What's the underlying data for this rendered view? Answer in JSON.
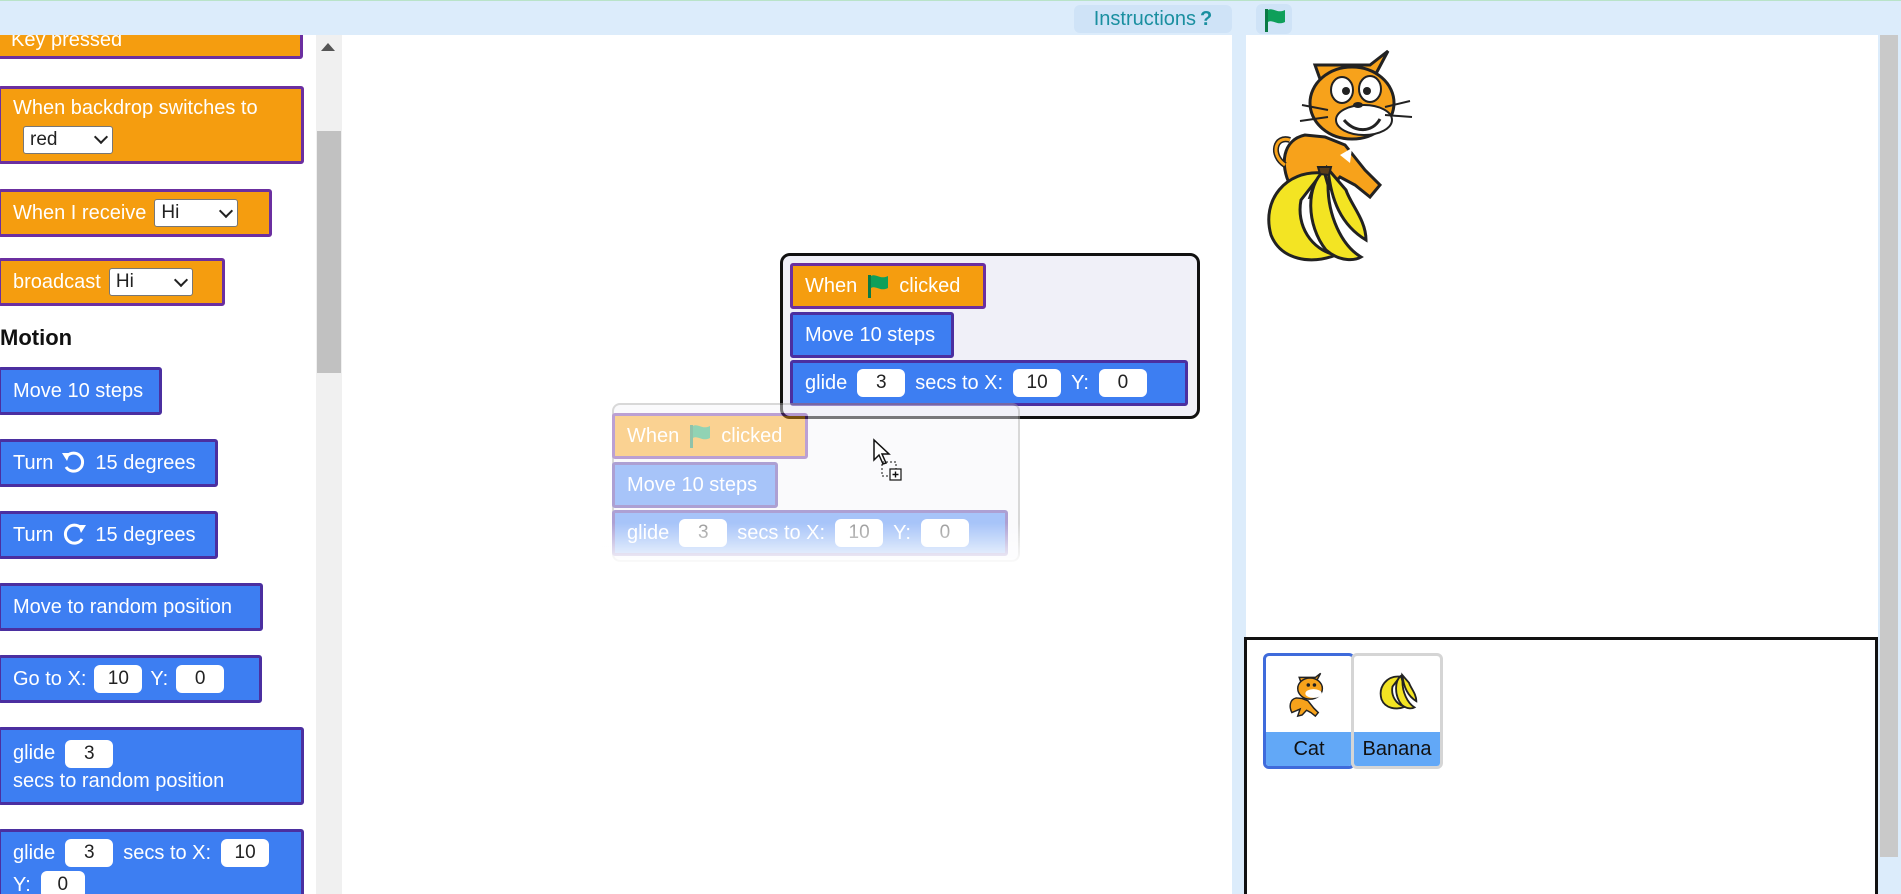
{
  "topbar": {
    "instructions_label": "Instructions",
    "instructions_icon": "?",
    "green_flag_icon": "green-flag-icon"
  },
  "palette": {
    "key_pressed_label": "Key pressed",
    "backdrop": {
      "label": "When backdrop switches to",
      "value": "red"
    },
    "receive": {
      "label": "When I receive",
      "value": "Hi"
    },
    "broadcast": {
      "label": "broadcast",
      "value": "Hi"
    },
    "motion_heading": "Motion",
    "move": "Move 10 steps",
    "turn_left": {
      "label": "Turn",
      "suffix": "15 degrees",
      "icon": "rotate-left-icon"
    },
    "turn_right": {
      "label": "Turn",
      "suffix": "15 degrees",
      "icon": "rotate-right-icon"
    },
    "random_position": "Move to random position",
    "goto": {
      "label": "Go to X:",
      "x": "10",
      "y_label": "Y:",
      "y": "0"
    },
    "glide_random": {
      "label": "glide",
      "secs": "3",
      "suffix": "secs to random position"
    },
    "glide_xy": {
      "label": "glide",
      "secs": "3",
      "mid": "secs to X:",
      "x": "10",
      "y_label": "Y:",
      "y": "0"
    }
  },
  "script": {
    "when_label": "When",
    "clicked_label": "clicked",
    "move": "Move 10 steps",
    "glide_label": "glide",
    "glide_secs": "3",
    "glide_mid": "secs to X:",
    "glide_x": "10",
    "glide_y_label": "Y:",
    "glide_y": "0"
  },
  "sprites": [
    {
      "name": "Cat",
      "selected": true
    },
    {
      "name": "Banana",
      "selected": false
    }
  ],
  "colors": {
    "event": "#f59d0f",
    "motion": "#3d7ef2",
    "border": "#6b2fa0",
    "flag": "#0e9f5a"
  }
}
